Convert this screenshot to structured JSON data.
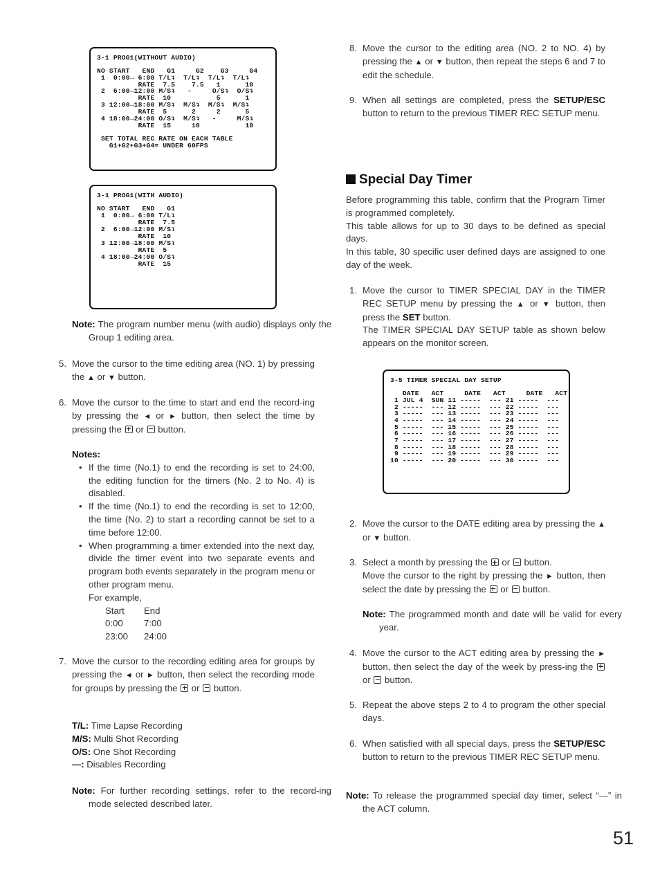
{
  "page_number": "51",
  "screen_without_audio": {
    "title": "3-1 PROG1(WITHOUT AUDIO)",
    "header": "NO START   END   G1     G2    G3     G4",
    "lines": [
      " 1  0:00→ 6:00 T/L↴  T/L↴  T/L↴  T/L↴",
      "          RATE  7.5    7.5   1      10",
      " 2  6:00→12:00 M/S↴   -     O/S↴  O/S↴",
      "          RATE  10           5      1",
      " 3 12:00→18:00 M/S↴  M/S↴  M/S↴  M/S↴",
      "          RATE  5      2     2      5",
      " 4 18:00→24:00 O/S↴  M/S↴   -     M/S↴",
      "          RATE  15     10           10"
    ],
    "footer_1": " SET TOTAL REC RATE ON EACH TABLE",
    "footer_2": "   G1+G2+G3+G4= UNDER 60FPS"
  },
  "screen_with_audio": {
    "title": "3-1 PROG1(WITH AUDIO)",
    "header": "NO START   END   G1",
    "lines": [
      " 1  0:00→ 6:00 T/L↴",
      "          RATE  7.5",
      " 2  6:00→12:00 M/S↴",
      "          RATE  10",
      " 3 12:00→18:00 M/S↴",
      "          RATE  5",
      " 4 18:00→24:00 O/S↴",
      "          RATE  15"
    ]
  },
  "screen_special_day": {
    "title": "3-5 TIMER SPECIAL DAY SETUP",
    "header": "   DATE   ACT     DATE   ACT     DATE   ACT",
    "lines": [
      " 1 JUL 4  SUN 11 -----  --- 21 -----  ---",
      " 2 -----  --- 12 -----  --- 22 -----  ---",
      " 3 -----  --- 13 -----  --- 23 -----  ---",
      " 4 -----  --- 14 -----  --- 24 -----  ---",
      " 5 -----  --- 15 -----  --- 25 -----  ---",
      " 6 -----  --- 16 -----  --- 26 -----  ---",
      " 7 -----  --- 17 -----  --- 27 -----  ---",
      " 8 -----  --- 18 -----  --- 28 -----  ---",
      " 9 -----  --- 19 -----  --- 29 -----  ---",
      "10 -----  --- 20 -----  --- 30 -----  ---"
    ]
  },
  "left": {
    "note_audio": {
      "label": "Note:",
      "text": " The program number menu (with audio) displays only the Group 1 editing area."
    },
    "step5": {
      "num": "5.",
      "text_a": "Move the cursor to the time editing area (NO. 1) by pressing the ",
      "or": " or ",
      "text_b": " button."
    },
    "step6": {
      "num": "6.",
      "text_a": "Move the cursor to the time to start and end the record-ing by pressing the ",
      "or": " or ",
      "text_b": " button, then select the time by pressing the ",
      "or2": " or ",
      "text_c": " button."
    },
    "notes": {
      "label": "Notes:",
      "bullets": [
        "If the time (No.1) to end the recording is set to 24:00, the editing function for the timers (No. 2 to No. 4) is disabled.",
        "If the time (No.1) to end the recording is set to 12:00, the time (No. 2) to start a recording cannot be set to a time before 12:00.",
        "When programming a timer extended into the next day, divide the timer event into two separate events and program both events separately in the program menu or other program menu."
      ],
      "example_intro": "For example,",
      "example_headers": [
        "Start",
        "End"
      ],
      "example_rows": [
        [
          "0:00",
          "7:00"
        ],
        [
          "23:00",
          "24:00"
        ]
      ]
    },
    "step7": {
      "num": "7.",
      "text_a": "Move the cursor to the recording editing area for groups by pressing the ",
      "or": " or ",
      "text_b": " button, then select the recording mode for groups by pressing the ",
      "or2": " or ",
      "text_c": " button."
    },
    "modes": [
      {
        "key": "T/L:",
        "desc": " Time Lapse Recording"
      },
      {
        "key": "M/S:",
        "desc": " Multi Shot Recording"
      },
      {
        "key": "O/S:",
        "desc": " One Shot Recording"
      },
      {
        "key": "—:",
        "desc": " Disables Recording"
      }
    ],
    "note_further": {
      "label": "Note:",
      "text": " For further recording settings, refer to the record-ing mode selected described later."
    }
  },
  "right": {
    "step8": {
      "num": "8.",
      "text_a": "Move the cursor to the editing area (NO. 2 to NO. 4) by pressing the ",
      "or": " or ",
      "text_b": " button, then repeat the steps 6 and 7 to edit the schedule."
    },
    "step9": {
      "num": "9.",
      "text_a": "When all settings are completed, press the ",
      "bold": "SETUP/ESC",
      "text_b": " button to return to the previous TIMER REC SETUP menu."
    },
    "section_title": "Special Day Timer",
    "intro": [
      "Before programming this table, confirm that the Program Timer is programmed completely.",
      "This table allows for up to 30 days to be defined as special days.",
      "In this table, 30 specific user defined days are assigned to one day of the week."
    ],
    "sd_step1": {
      "num": "1.",
      "text_a": "Move the cursor to TIMER SPECIAL DAY in the TIMER REC SETUP menu by pressing the ",
      "or": " or ",
      "text_b": " button, then press the ",
      "bold": "SET",
      "text_c": " button.",
      "text_d": "The TIMER SPECIAL DAY SETUP table as shown below appears on the monitor screen."
    },
    "sd_step2": {
      "num": "2.",
      "text_a": "Move the cursor to the DATE editing area by pressing the ",
      "or": " or ",
      "text_b": " button."
    },
    "sd_step3": {
      "num": "3.",
      "text_a": "Select a month by pressing the ",
      "or": " or ",
      "text_b": " button.",
      "text_c": "Move the cursor to the right by pressing the ",
      "text_d": " button, then select the date by pressing the ",
      "or2": " or ",
      "text_e": " button."
    },
    "sd_note_valid": {
      "label": "Note:",
      "text": " The programmed month and date will be valid for every year."
    },
    "sd_step4": {
      "num": "4.",
      "text_a": "Move the cursor to the ACT editing area by pressing the ",
      "text_b": " button, then select the day of the week by press-ing the ",
      "or": " or ",
      "text_c": " button."
    },
    "sd_step5": {
      "num": "5.",
      "text": "Repeat the above steps 2 to 4 to program the other special days."
    },
    "sd_step6": {
      "num": "6.",
      "text_a": "When satisfied with all special days, press the ",
      "bold": "SETUP/ESC",
      "text_b": " button to return to the previous TIMER REC SETUP menu."
    },
    "sd_note_release": {
      "label": "Note:",
      "text": " To release the programmed special day timer, select “---” in the ACT column."
    }
  },
  "icons": {
    "up": "▲",
    "down": "▼",
    "left": "◄",
    "right": "►"
  }
}
